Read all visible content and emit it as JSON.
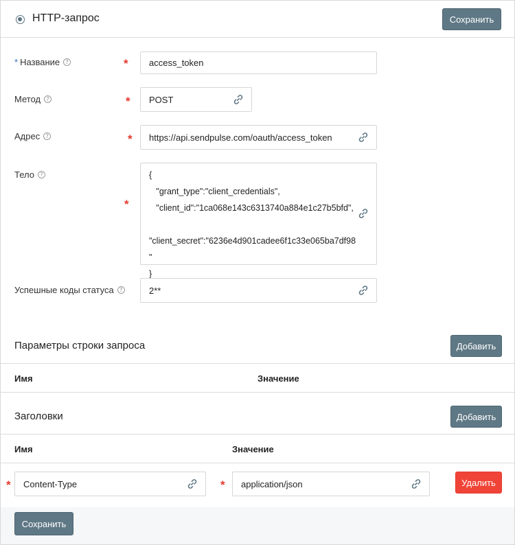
{
  "header": {
    "title": "HTTP-запрос",
    "save_label": "Сохранить"
  },
  "form": {
    "name": {
      "label": "Название",
      "value": "access_token"
    },
    "method": {
      "label": "Метод",
      "value": "POST"
    },
    "address": {
      "label": "Адрес",
      "value": "https://api.sendpulse.com/oauth/access_token"
    },
    "body": {
      "label": "Тело",
      "value": "{\n   \"grant_type\":\"client_credentials\",\n   \"client_id\":\"1ca068e143c6313740a884e1c27b5bfd\",\n\n\"client_secret\":\"6236e4d901cadee6f1c33e065ba7df98\n\"\n}"
    },
    "status_codes": {
      "label": "Успешные коды статуса",
      "value": "2**"
    }
  },
  "query_params": {
    "title": "Параметры строки запроса",
    "add_label": "Добавить",
    "columns": [
      "Имя",
      "Значение"
    ]
  },
  "headers_section": {
    "title": "Заголовки",
    "add_label": "Добавить",
    "columns": [
      "Имя",
      "Значение"
    ],
    "rows": [
      {
        "name": "Content-Type",
        "value": "application/json",
        "delete_label": "Удалить"
      }
    ]
  },
  "footer": {
    "save_label": "Сохранить"
  },
  "icons": {
    "help": "question-circle-icon",
    "link": "link-icon",
    "radio": "radio-icon"
  },
  "colors": {
    "primary_button": "#5f7885",
    "danger_button": "#f04438",
    "required": "#e53a2f"
  }
}
